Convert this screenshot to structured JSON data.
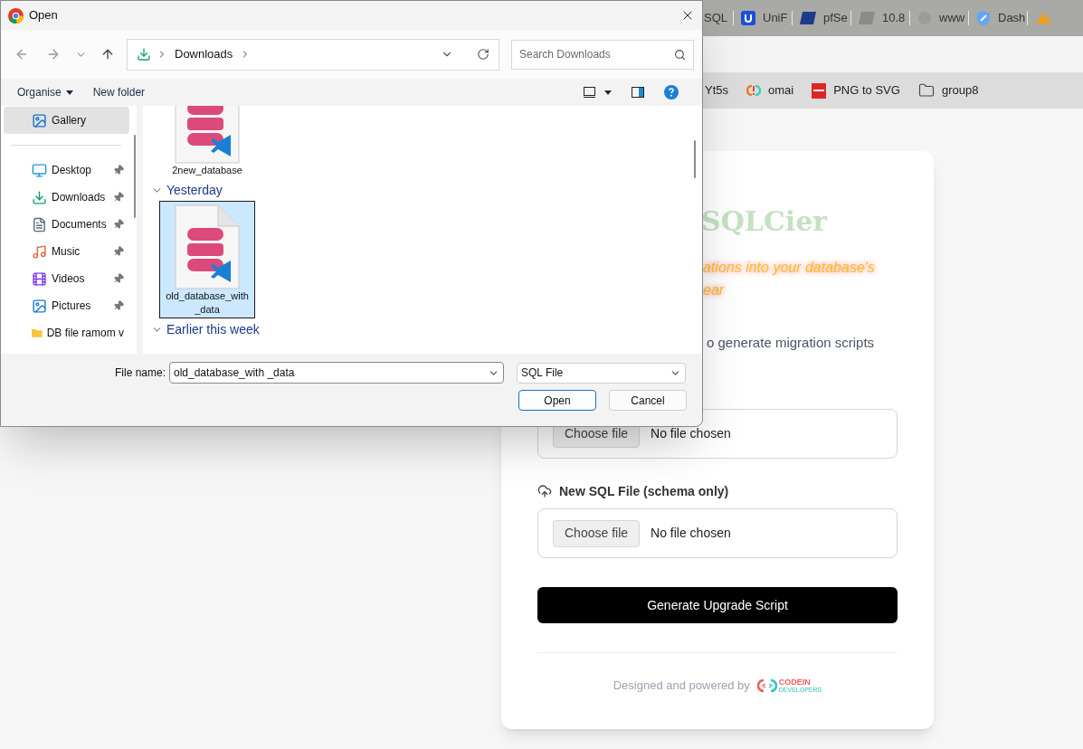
{
  "browser": {
    "tabs": [
      {
        "label": "SQL",
        "kind": "hidden"
      },
      {
        "label": "UniF",
        "kind": "unifi"
      },
      {
        "label": "pfSe",
        "kind": "pf"
      },
      {
        "label": "10.8",
        "kind": "pf-gray"
      },
      {
        "label": "www",
        "kind": "blank"
      },
      {
        "label": "Dash",
        "kind": "shield"
      },
      {
        "kind": "pma"
      }
    ],
    "bookmarks": [
      {
        "label": "Yt5s",
        "kind": "hidden"
      },
      {
        "label": "omai",
        "kind": "omai"
      },
      {
        "label": "PNG to SVG",
        "kind": "png"
      },
      {
        "label": "group8",
        "kind": "folder"
      }
    ]
  },
  "page": {
    "title": "SQLCier",
    "tagline_lines": [
      "ations into your database's",
      "ear"
    ],
    "description": "o generate migration scripts",
    "file_inputs": [
      {
        "button": "Choose file",
        "status": "No file chosen"
      },
      {
        "label": "New SQL File (schema only)",
        "button": "Choose file",
        "status": "No file chosen"
      }
    ],
    "submit": "Generate Upgrade Script",
    "footer": "Designed and powered by",
    "logo": {
      "name": "CODEIN",
      "sub": "DEVELOPERS"
    }
  },
  "dialog": {
    "title": "Open",
    "breadcrumb": [
      "Downloads"
    ],
    "search_placeholder": "Search Downloads",
    "organise": "Organise",
    "new_folder": "New folder",
    "nav_items": [
      {
        "label": "Gallery",
        "kind": "gallery",
        "selected": true,
        "pinned": false
      },
      {
        "label": "Desktop",
        "kind": "desktop",
        "selected": false,
        "pinned": true
      },
      {
        "label": "Downloads",
        "kind": "downloads",
        "selected": false,
        "pinned": true
      },
      {
        "label": "Documents",
        "kind": "documents",
        "selected": false,
        "pinned": true
      },
      {
        "label": "Music",
        "kind": "music",
        "selected": false,
        "pinned": true
      },
      {
        "label": "Videos",
        "kind": "videos",
        "selected": false,
        "pinned": true
      },
      {
        "label": "Pictures",
        "kind": "pictures",
        "selected": false,
        "pinned": true
      },
      {
        "label": "DB file ramom v",
        "kind": "folder",
        "selected": false,
        "pinned": false
      }
    ],
    "groups": [
      {
        "files": [
          {
            "name": "2new_database",
            "selected": false
          }
        ]
      },
      {
        "header": "Yesterday",
        "files": [
          {
            "name": "old_database_with _data",
            "selected": true
          }
        ]
      },
      {
        "header": "Earlier this week"
      }
    ],
    "file_name_label": "File name:",
    "file_name": "old_database_with _data",
    "file_type": "SQL File",
    "buttons": [
      {
        "label": "Open",
        "kind": "primary"
      },
      {
        "label": "Cancel",
        "kind": "secondary"
      }
    ]
  }
}
